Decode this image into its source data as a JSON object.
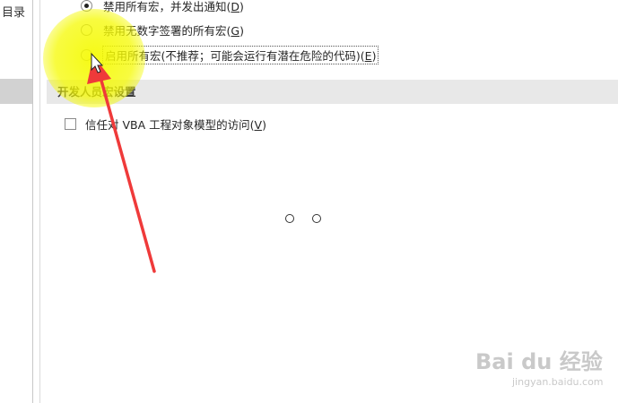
{
  "nav": {
    "items": [
      {
        "label": "目录"
      }
    ]
  },
  "macro_settings": {
    "options": [
      {
        "text": "禁用所有宏，并发出通知",
        "accel": "D",
        "checked": true
      },
      {
        "text": "禁用无数字签署的所有宏",
        "accel": "G",
        "checked": false
      },
      {
        "text": "启用所有宏(不推荐；可能会运行有潜在危险的代码)",
        "accel": "E",
        "checked": false
      }
    ]
  },
  "developer_section": {
    "title": "开发人员宏设置",
    "trust_vba": {
      "text": "信任对 VBA 工程对象模型的访问",
      "accel": "V",
      "checked": false
    }
  },
  "watermark": {
    "brand": "Bai du 经验",
    "url": "jingyan.baidu.com"
  },
  "colors": {
    "highlight": "#f5fa00",
    "arrow": "#ef3a3a",
    "section_bg": "#e8e8e8",
    "nav_selected": "#d2d2d2"
  }
}
